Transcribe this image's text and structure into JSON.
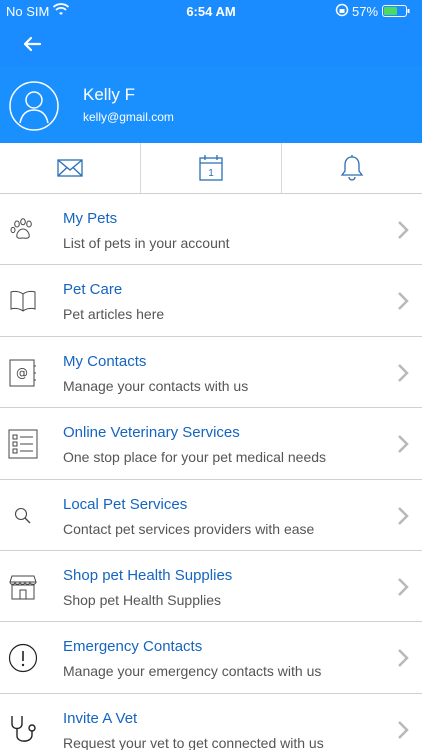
{
  "status_bar": {
    "carrier": "No SIM",
    "time": "6:54 AM",
    "battery": "57%"
  },
  "profile": {
    "name": "Kelly F",
    "email": "kelly@gmail.com"
  },
  "quick_actions": [
    {
      "icon": "mail-icon"
    },
    {
      "icon": "calendar-icon",
      "day": "1"
    },
    {
      "icon": "bell-icon"
    }
  ],
  "menu": [
    {
      "title": "My Pets",
      "subtitle": "List of pets in your account",
      "icon": "paw-icon"
    },
    {
      "title": "Pet Care",
      "subtitle": "Pet articles here",
      "icon": "book-icon"
    },
    {
      "title": "My Contacts",
      "subtitle": "Manage your contacts with us",
      "icon": "address-book-icon"
    },
    {
      "title": "Online Veterinary Services",
      "subtitle": "One stop place for your pet medical needs",
      "icon": "list-icon"
    },
    {
      "title": "Local Pet Services",
      "subtitle": "Contact pet services providers with ease",
      "icon": "search-icon"
    },
    {
      "title": "Shop pet Health Supplies",
      "subtitle": "Shop pet Health Supplies",
      "icon": "store-icon"
    },
    {
      "title": "Emergency Contacts",
      "subtitle": "Manage your emergency contacts with us",
      "icon": "alert-icon"
    },
    {
      "title": "Invite A Vet",
      "subtitle": "Request your vet to get connected with us",
      "icon": "stethoscope-icon"
    }
  ],
  "colors": {
    "header_blue": "#1a8cff",
    "title_blue": "#1565c0",
    "icon_blue": "#2a6fb5"
  }
}
